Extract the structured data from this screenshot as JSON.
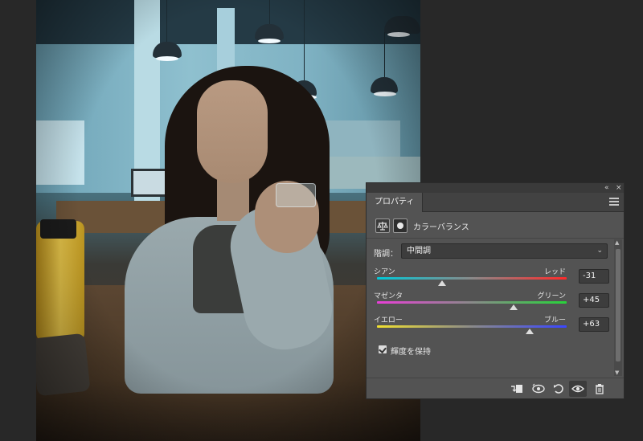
{
  "panel": {
    "tab_label": "プロパティ",
    "collapse_label": "«",
    "close_label": "×",
    "adjustment_title": "カラーバランス",
    "tone_label": "階調：",
    "tone_value": "中間調",
    "sliders": [
      {
        "left": "シアン",
        "right": "レッド",
        "value": "-31"
      },
      {
        "left": "マゼンタ",
        "right": "グリーン",
        "value": "+45"
      },
      {
        "left": "イエロー",
        "right": "ブルー",
        "value": "+63"
      }
    ],
    "preserve_luminosity": "輝度を保持",
    "preserve_checked": true
  },
  "icons": {
    "header": [
      "scale-icon",
      "mask-icon"
    ],
    "footer": [
      "clip-to-layer-icon",
      "view-previous-state-icon",
      "reset-icon",
      "visibility-eye-icon",
      "trash-icon"
    ]
  },
  "colors": {
    "panel_bg": "#535353",
    "panel_dark": "#3d3d3d",
    "workspace_bg": "#282828"
  }
}
